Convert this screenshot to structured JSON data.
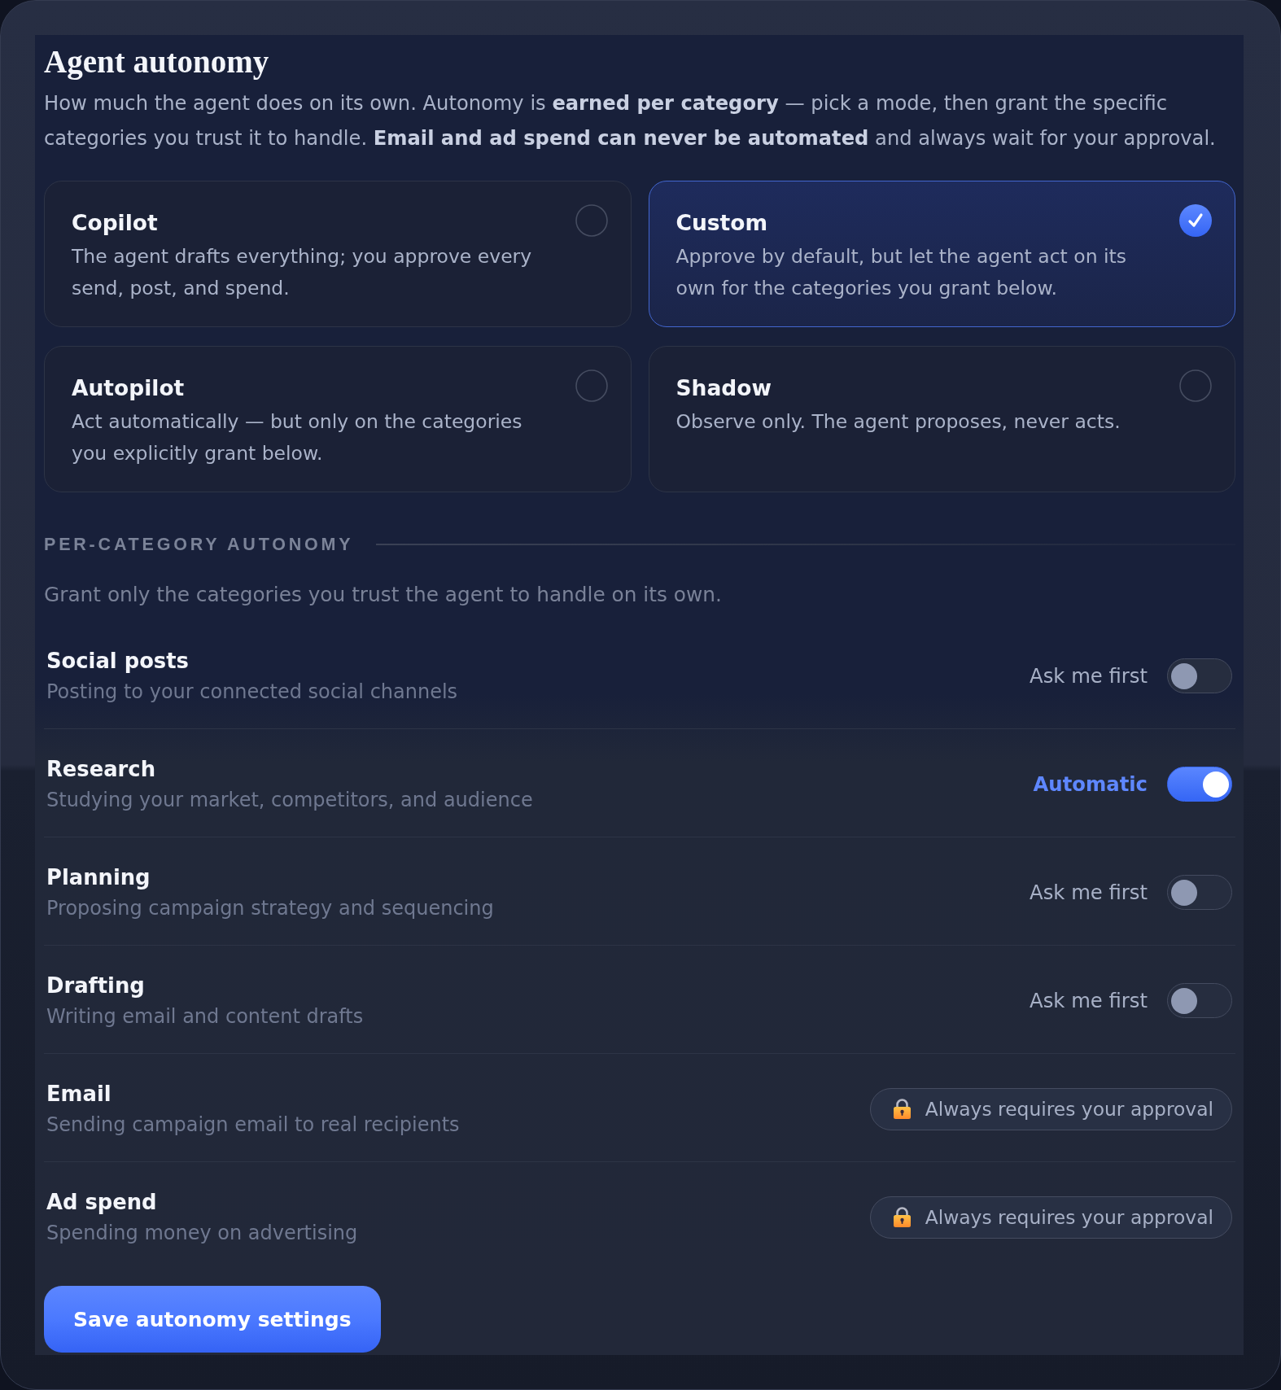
{
  "header": {
    "title": "Agent autonomy",
    "description": "How much the agent does on its own. Autonomy is **earned per category** — pick a mode, then grant the specific categories you trust it to handle. **Email and ad spend can never be automated** and always wait for your approval."
  },
  "modes": [
    {
      "title": "Copilot",
      "description": "The agent drafts everything; you approve every send, post, and spend.",
      "selected": false
    },
    {
      "title": "Custom",
      "description": "Approve by default, but let the agent act on its own for the categories you grant below.",
      "selected": true
    },
    {
      "title": "Autopilot",
      "description": "Act automatically — but only on the categories you explicitly grant below.",
      "selected": false
    },
    {
      "title": "Shadow",
      "description": "Observe only. The agent proposes, never acts.",
      "selected": false
    }
  ],
  "per_category": {
    "heading": "PER-CATEGORY AUTONOMY",
    "subtitle": "Grant only the categories you trust the agent to handle on its own.",
    "categories": [
      {
        "kind": "toggle",
        "name": "Social posts",
        "description": "Posting to your connected social channels",
        "status": "Ask me first",
        "on": false
      },
      {
        "kind": "toggle",
        "name": "Research",
        "description": "Studying your market, competitors, and audience",
        "status": "Automatic",
        "on": true
      },
      {
        "kind": "toggle",
        "name": "Planning",
        "description": "Proposing campaign strategy and sequencing",
        "status": "Ask me first",
        "on": false
      },
      {
        "kind": "toggle",
        "name": "Drafting",
        "description": "Writing email and content drafts",
        "status": "Ask me first",
        "on": false
      },
      {
        "kind": "locked",
        "name": "Email",
        "description": "Sending campaign email to real recipients",
        "badge": "Always requires your approval"
      },
      {
        "kind": "locked",
        "name": "Ad spend",
        "description": "Spending money on advertising",
        "badge": "Always requires your approval"
      }
    ]
  },
  "save_button": "Save autonomy settings"
}
